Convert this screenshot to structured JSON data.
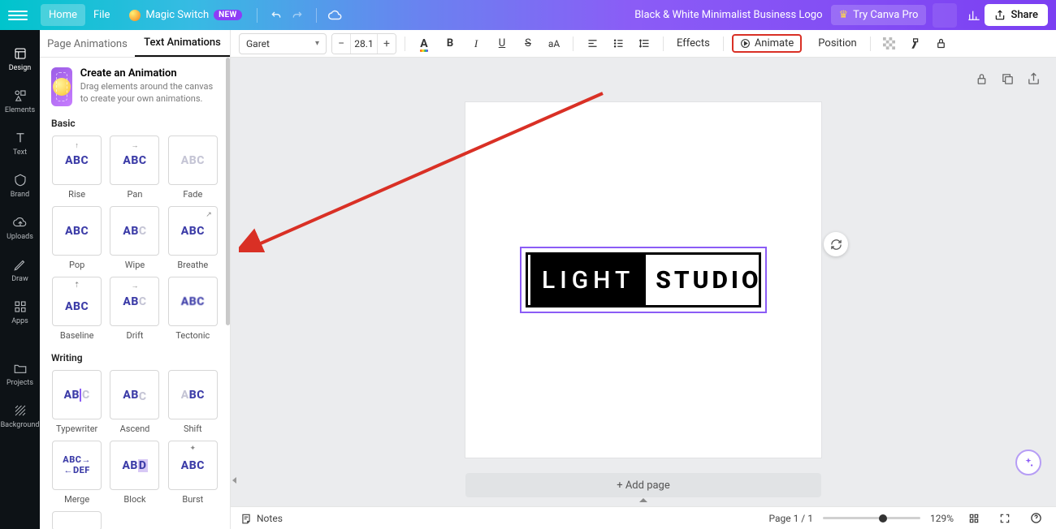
{
  "topbar": {
    "home": "Home",
    "file": "File",
    "magic": "Magic Switch",
    "new_badge": "NEW",
    "doc_name": "Black & White Minimalist Business Logo",
    "try_pro": "Try Canva Pro",
    "share": "Share"
  },
  "nav": {
    "design": "Design",
    "elements": "Elements",
    "text": "Text",
    "brand": "Brand",
    "uploads": "Uploads",
    "draw": "Draw",
    "apps": "Apps",
    "projects": "Projects",
    "background": "Background"
  },
  "tabs": {
    "page_anim": "Page Animations",
    "text_anim": "Text Animations"
  },
  "promo": {
    "title": "Create an Animation",
    "subtitle": "Drag elements around the canvas to create your own animations."
  },
  "section_basic": "Basic",
  "section_writing": "Writing",
  "anims_basic": [
    "Rise",
    "Pan",
    "Fade",
    "Pop",
    "Wipe",
    "Breathe",
    "Baseline",
    "Drift",
    "Tectonic"
  ],
  "anims_writing": [
    "Typewriter",
    "Ascend",
    "Shift",
    "Merge",
    "Block",
    "Burst"
  ],
  "toolbar": {
    "font": "Garet",
    "font_size": "28.1",
    "effects": "Effects",
    "animate": "Animate",
    "position": "Position"
  },
  "logo": {
    "left": "LIGHT",
    "right": "STUDIO"
  },
  "addpage": "+ Add page",
  "status": {
    "notes": "Notes",
    "page": "Page 1 / 1",
    "zoom": "129%"
  }
}
